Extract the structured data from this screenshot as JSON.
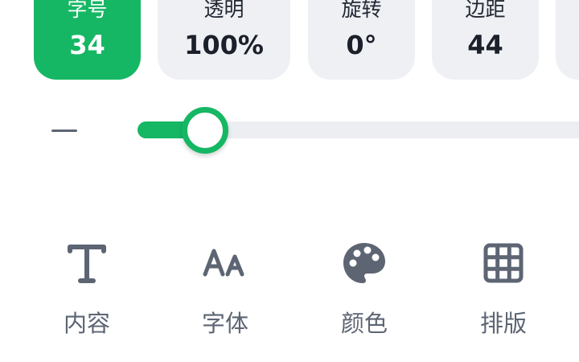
{
  "colors": {
    "accent": "#16b764",
    "card_bg": "#eef0f4",
    "icon_gray": "#5d6573",
    "track_bg": "#eceef2"
  },
  "property_cards": [
    {
      "label": "字号",
      "value": "34",
      "active": true
    },
    {
      "label": "透明",
      "value": "100%",
      "active": false
    },
    {
      "label": "旋转",
      "value": "0°",
      "active": false
    },
    {
      "label": "边距",
      "value": "44",
      "active": false
    },
    {
      "label": "",
      "value": "",
      "active": false
    }
  ],
  "slider": {
    "decrement_icon": "minus-icon",
    "value_fraction": 0.12
  },
  "toolbar": {
    "items": [
      {
        "label": "内容",
        "icon": "text-icon"
      },
      {
        "label": "字体",
        "icon": "font-size-icon"
      },
      {
        "label": "颜色",
        "icon": "palette-icon"
      },
      {
        "label": "排版",
        "icon": "grid-icon"
      }
    ]
  }
}
